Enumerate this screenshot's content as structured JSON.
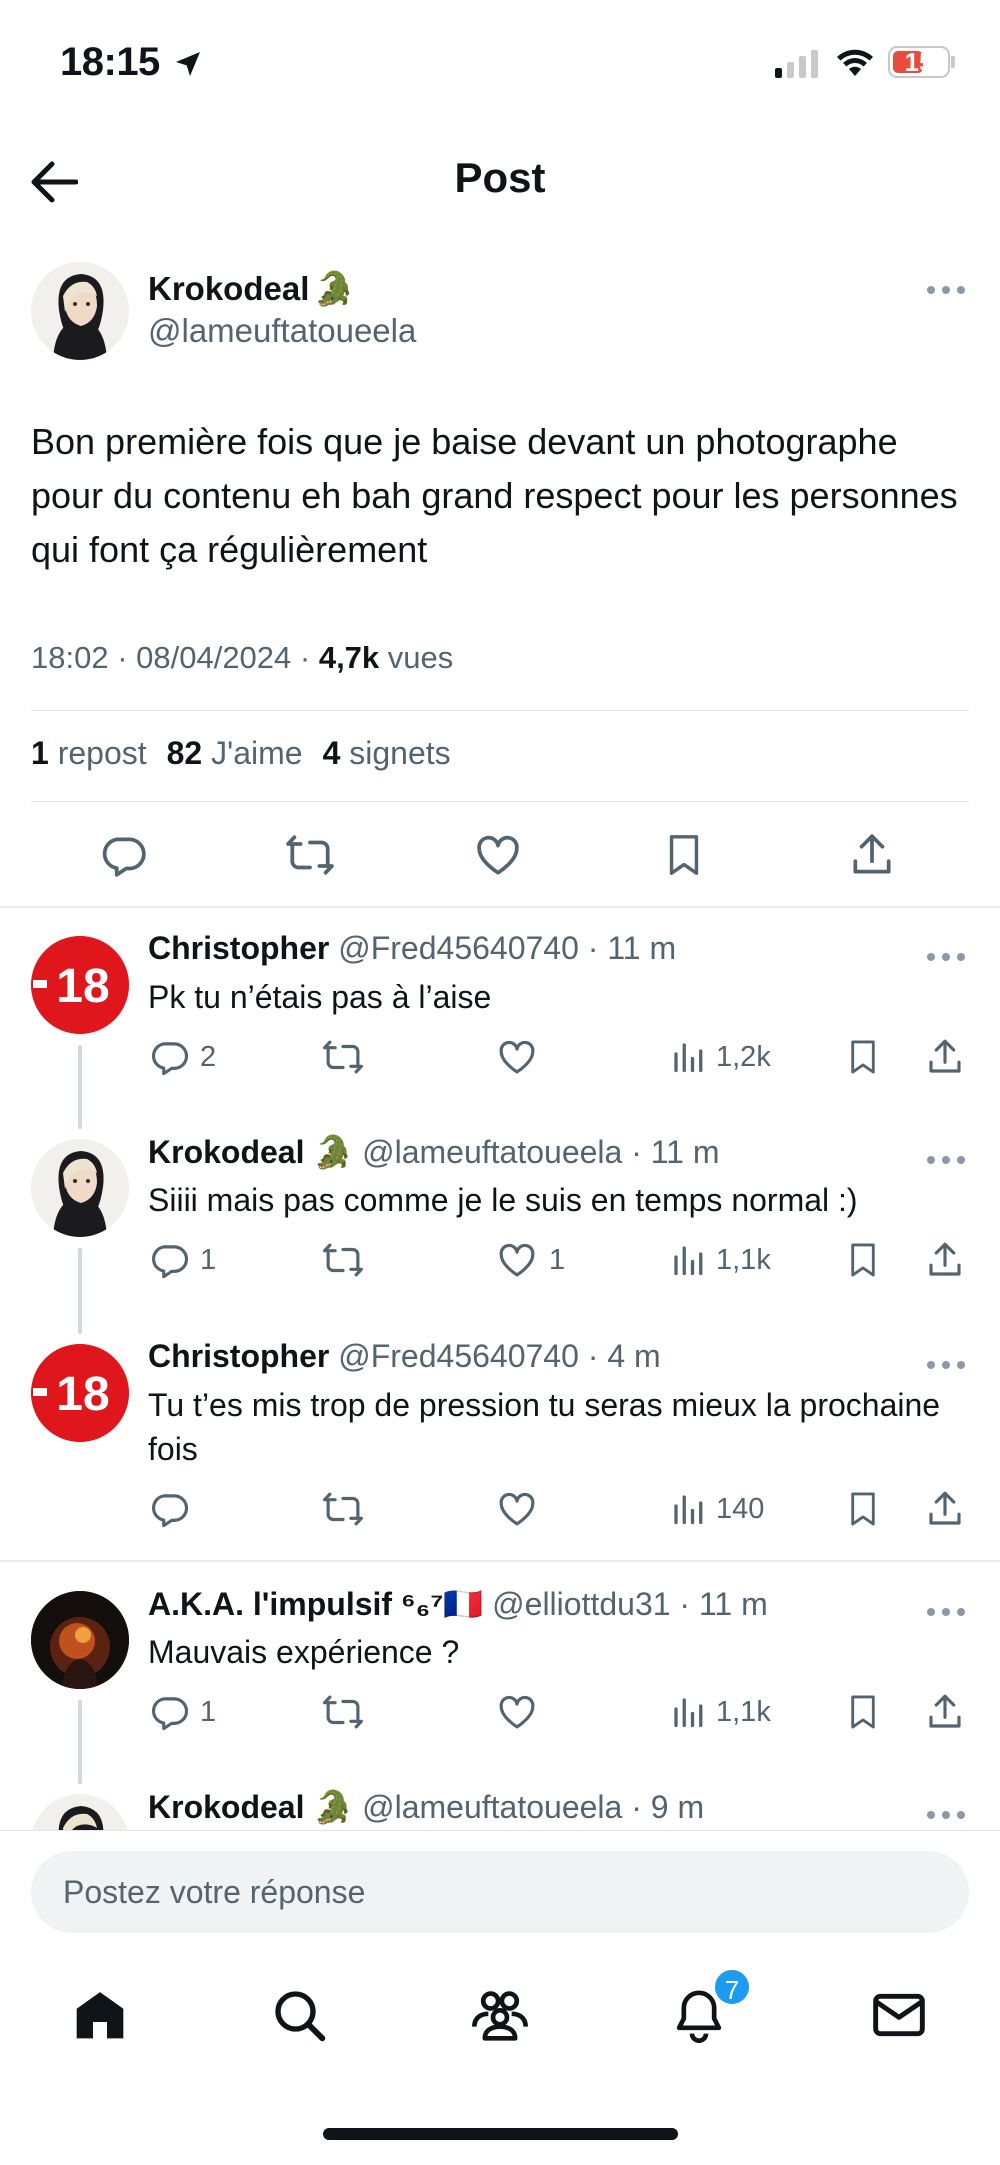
{
  "status_bar": {
    "time": "18:15",
    "battery": "15"
  },
  "nav": {
    "title": "Post"
  },
  "post": {
    "author_name": "Krokodeal",
    "author_emoji": "🐊",
    "author_handle": "@lameuftatoueela",
    "text": "Bon première fois que je baise devant un photographe pour du contenu eh bah grand respect pour les personnes qui font ça régulièrement",
    "time": "18:02 · 08/04/2024 · ",
    "views_count": "4,7k",
    "views_label": " vues",
    "reposts_count": "1",
    "reposts_label": " repost",
    "likes_count": "82",
    "likes_label": " J'aime",
    "bookmarks_count": "4",
    "bookmarks_label": " signets"
  },
  "replies": [
    {
      "name": "Christopher",
      "handle": "@Fred45640740",
      "time": " · 11 m",
      "text": "Pk tu n’étais pas à l’aise",
      "replies": "2",
      "likes": "",
      "views": "1,2k",
      "avatar": "18"
    },
    {
      "name": "Krokodeal",
      "emoji": "🐊",
      "handle": "@lameuftatoueela",
      "time": " · 11 m",
      "text": "Siiii mais pas comme je le suis en temps normal :)",
      "replies": "1",
      "likes": "1",
      "views": "1,1k"
    },
    {
      "name": "Christopher",
      "handle": "@Fred45640740",
      "time": " · 4 m",
      "text": "Tu t’es mis trop de pression tu seras mieux la prochaine fois",
      "replies": "",
      "likes": "",
      "views": "140",
      "avatar": "18"
    },
    {
      "name": "A.K.A. l'impulsif ⁶₆⁷🇫🇷",
      "handle": "@elliottdu31",
      "time": " · 11 m",
      "text": "Mauvais expérience ?",
      "replies": "1",
      "likes": "",
      "views": "1,1k"
    },
    {
      "name": "Krokodeal",
      "emoji": "🐊",
      "handle": "@lameuftatoueela",
      "time": " · 9 m"
    }
  ],
  "reply_bar": {
    "placeholder": "Postez votre réponse"
  },
  "tab_bar": {
    "notifications_badge": "7"
  },
  "colors": {
    "accent": "#1d9bf0",
    "text": "#0f1419",
    "secondary": "#536471",
    "avatar_red": "#e0161d"
  },
  "icons": [
    "location-arrow-icon",
    "signal-icon",
    "wifi-icon",
    "battery-icon",
    "back-arrow-icon",
    "more-icon",
    "reply-icon",
    "repost-icon",
    "like-icon",
    "bookmark-icon",
    "share-icon",
    "views-icon",
    "home-icon",
    "search-icon",
    "communities-icon",
    "notifications-icon",
    "messages-icon"
  ]
}
